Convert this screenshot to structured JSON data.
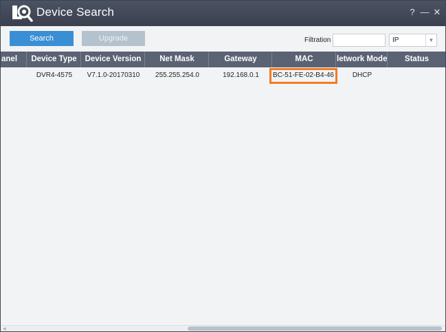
{
  "window": {
    "title": "Device Search",
    "controls": {
      "help": "?",
      "minimize": "—",
      "close": "✕"
    },
    "logo_icon": "camera-search-icon"
  },
  "toolbar": {
    "search_label": "Search",
    "upgrade_label": "Upgrade",
    "filtration_label": "Filtration",
    "filter_value": "",
    "filter_type_selected": "IP"
  },
  "table": {
    "columns": [
      "anel",
      "Device Type",
      "Device Version",
      "Net Mask",
      "Gateway",
      "MAC",
      "letwork Mode",
      "Status"
    ],
    "rows": [
      {
        "channel": "",
        "device_type": "DVR4-4575",
        "device_version": "V7.1.0-20170310",
        "net_mask": "255.255.254.0",
        "gateway": "192.168.0.1",
        "mac": "BC-51-FE-02-B4-46",
        "network_mode": "DHCP",
        "status": ""
      }
    ],
    "highlight_color": "#f07c26"
  }
}
